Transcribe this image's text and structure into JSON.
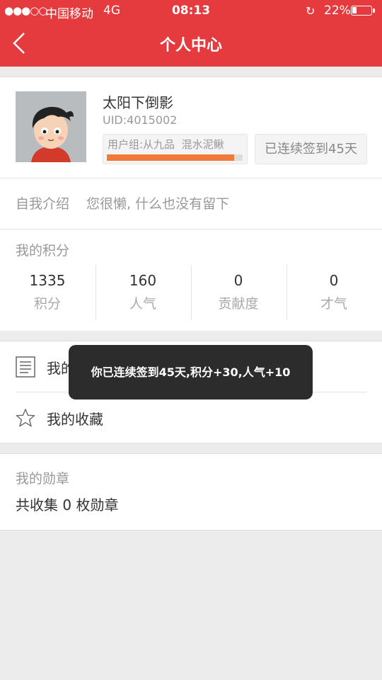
{
  "status_bar": {
    "signal": "●●●○○",
    "carrier": "中国移动",
    "network": "4G",
    "time": "08:13",
    "battery_percent": "22%"
  },
  "header": {
    "title": "个人中心",
    "back_icon": "chevron-left-icon"
  },
  "profile": {
    "username": "太阳下倒影",
    "uid": "UID:4015002",
    "group": "用户组:从九品",
    "group_title": "混水泥鳅",
    "level_progress": 0.94,
    "checkin_badge": "已连续签到45天",
    "bio_label": "自我介绍",
    "bio_text": "您很懒, 什么也没有留下"
  },
  "points": {
    "title": "我的积分",
    "stats": [
      {
        "value": "1335",
        "label": "积分"
      },
      {
        "value": "160",
        "label": "人气"
      },
      {
        "value": "0",
        "label": "贡献度"
      },
      {
        "value": "0",
        "label": "才气"
      }
    ]
  },
  "menu": {
    "items": [
      {
        "label": "我的帖子",
        "icon": "document-icon"
      },
      {
        "label": "我的收藏",
        "icon": "star-icon"
      }
    ]
  },
  "medals": {
    "title": "我的勋章",
    "summary": "共收集 0 枚勋章"
  },
  "toast": {
    "message": "你已连续签到45天,积分+30,人气+10"
  },
  "colors": {
    "brand_red": "#e63b3e",
    "progress_orange": "#f07a3a"
  }
}
